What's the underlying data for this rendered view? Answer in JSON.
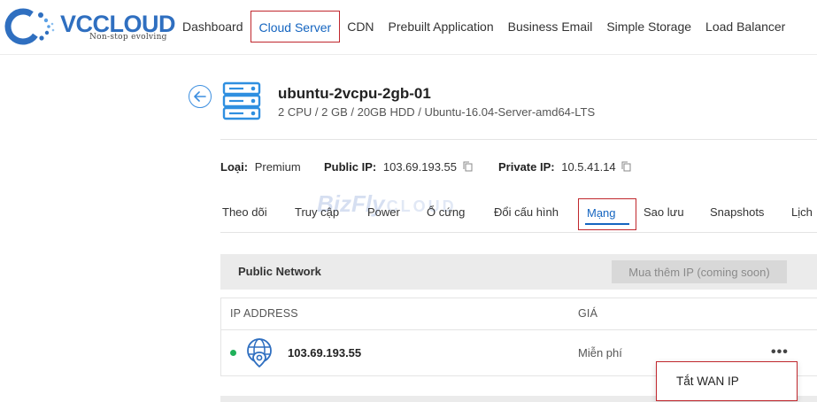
{
  "brand": {
    "name": "VCCLOUD",
    "tagline": "Non-stop evolving"
  },
  "nav": {
    "items": [
      {
        "label": "Dashboard",
        "active": false
      },
      {
        "label": "Cloud Server",
        "active": true
      },
      {
        "label": "CDN",
        "active": false
      },
      {
        "label": "Prebuilt Application",
        "active": false
      },
      {
        "label": "Business Email",
        "active": false
      },
      {
        "label": "Simple Storage",
        "active": false
      },
      {
        "label": "Load Balancer",
        "active": false
      }
    ]
  },
  "server": {
    "name": "ubuntu-2vcpu-2gb-01",
    "spec": "2 CPU / 2 GB / 20GB HDD / Ubuntu-16.04-Server-amd64-LTS"
  },
  "info": {
    "type_label": "Loại:",
    "type_value": "Premium",
    "public_ip_label": "Public IP:",
    "public_ip_value": "103.69.193.55",
    "private_ip_label": "Private IP:",
    "private_ip_value": "10.5.41.14"
  },
  "watermark": {
    "text": "BizFly",
    "suffix": "CLOUD"
  },
  "tabs": [
    {
      "label": "Theo dõi",
      "active": false
    },
    {
      "label": "Truy cập",
      "active": false
    },
    {
      "label": "Power",
      "active": false
    },
    {
      "label": "Ổ cứng",
      "active": false
    },
    {
      "label": "Đổi cấu hình",
      "active": false
    },
    {
      "label": "Mạng",
      "active": true
    },
    {
      "label": "Sao lưu",
      "active": false
    },
    {
      "label": "Snapshots",
      "active": false
    },
    {
      "label": "Lịch",
      "active": false
    }
  ],
  "network": {
    "title": "Public Network",
    "buy_button": "Mua thêm IP (coming soon)",
    "columns": [
      "IP ADDRESS",
      "GIÁ"
    ],
    "rows": [
      {
        "ip": "103.69.193.55",
        "price": "Miễn phí",
        "status": "active",
        "more": "•••"
      }
    ]
  },
  "dropdown": {
    "items": [
      "Tắt WAN IP"
    ]
  },
  "colors": {
    "brand": "#2f6fc0",
    "accent": "#1565c0",
    "highlight_border": "#c0272d",
    "status_active": "#20b15a"
  }
}
